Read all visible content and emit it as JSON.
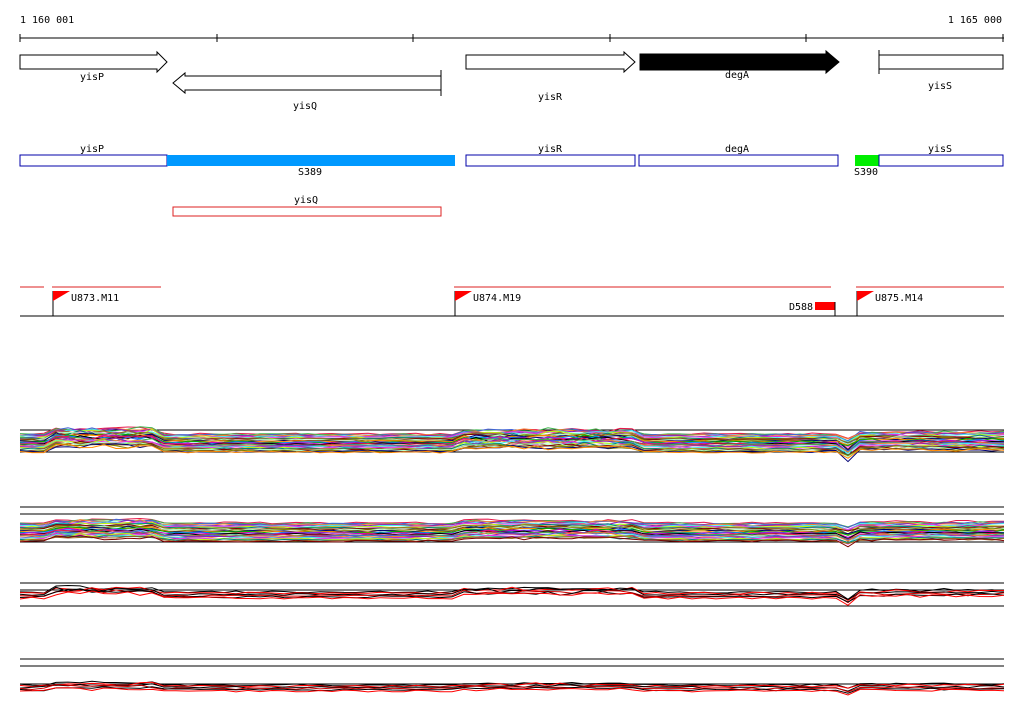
{
  "ruler": {
    "start_label": "1 160 001",
    "end_label": "1 165 000"
  },
  "genes": [
    {
      "name": "yisP",
      "strand": "+",
      "fill": "#ffffff"
    },
    {
      "name": "yisQ",
      "strand": "-",
      "fill": "#ffffff"
    },
    {
      "name": "yisR",
      "strand": "+",
      "fill": "#ffffff"
    },
    {
      "name": "degA",
      "strand": "+",
      "fill": "#000000"
    },
    {
      "name": "yisS",
      "strand": "+",
      "fill": "#ffffff"
    }
  ],
  "segments": [
    {
      "name": "yisP",
      "color": "#0000aa",
      "filled": false
    },
    {
      "name": "S389",
      "color": "#0099ff",
      "filled": true
    },
    {
      "name": "yisR",
      "color": "#0000aa",
      "filled": false
    },
    {
      "name": "degA",
      "color": "#0000aa",
      "filled": false
    },
    {
      "name": "S390",
      "color": "#00ee00",
      "filled": true
    },
    {
      "name": "yisS",
      "color": "#0000aa",
      "filled": false
    }
  ],
  "antisense": [
    {
      "name": "yisQ",
      "color": "#dd2222"
    }
  ],
  "units": [
    {
      "name": "U873.M11"
    },
    {
      "name": "U874.M19"
    },
    {
      "name": "U875.M14"
    }
  ],
  "downshift": {
    "name": "D588",
    "color": "#ff0000"
  },
  "colors": {
    "flag": "#ff0000",
    "unit_line": "#dd2222"
  }
}
